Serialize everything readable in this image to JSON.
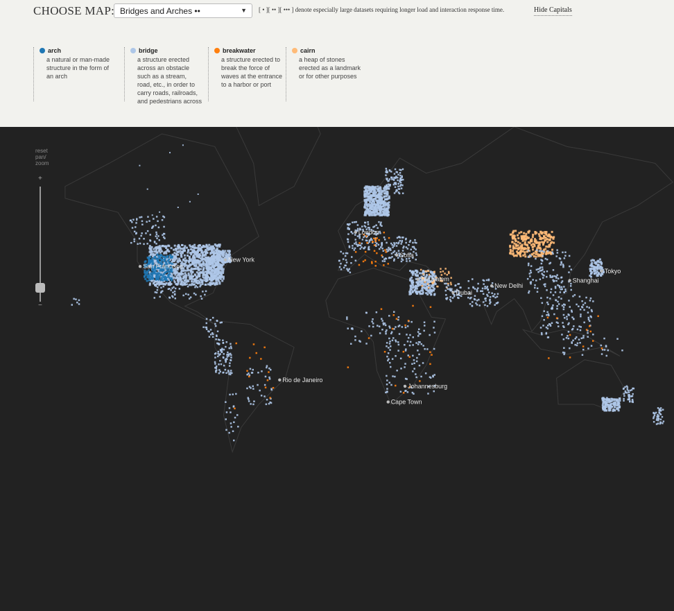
{
  "header": {
    "choose_label": "CHOOSE MAP:",
    "select_value": "Bridges and Arches ••",
    "note": "[ • ][ •• ][ ••• ] denote especially large datasets requiring longer load and interaction response time.",
    "hide_capitals": "Hide Capitals"
  },
  "legend": [
    {
      "name": "arch",
      "color": "#1f77b4",
      "desc": [
        "a natural or man-made",
        "structure in the form of",
        "an arch"
      ]
    },
    {
      "name": "bridge",
      "color": "#aec7e8",
      "desc": [
        "a structure erected",
        "across an obstacle",
        "such as a stream,",
        "road, etc., in order to",
        "carry roads, railroads,",
        "and pedestrians across"
      ]
    },
    {
      "name": "breakwater",
      "color": "#ff7f0e",
      "desc": [
        "a structure erected to",
        "break the force of",
        "waves at the entrance",
        "to a harbor or port"
      ]
    },
    {
      "name": "cairn",
      "color": "#ffbb78",
      "desc": [
        "a heap of stones",
        "erected as a landmark",
        "or for other purposes"
      ]
    }
  ],
  "zoom": {
    "label": [
      "reset",
      "pan/",
      "zoom"
    ],
    "plus": "+",
    "minus": "−",
    "level": 0.08
  },
  "cities": [
    {
      "name": "London",
      "lon": -0.1,
      "lat": 51.5
    },
    {
      "name": "Sofia",
      "lon": 23.3,
      "lat": 42.7
    },
    {
      "name": "Jerusalem",
      "lon": 35.2,
      "lat": 31.8
    },
    {
      "name": "Dubai",
      "lon": 55.3,
      "lat": 25.2
    },
    {
      "name": "New Delhi",
      "lon": 77.2,
      "lat": 28.6
    },
    {
      "name": "Shanghai",
      "lon": 121.5,
      "lat": 31.2
    },
    {
      "name": "Tokyo",
      "lon": 139.7,
      "lat": 35.7
    },
    {
      "name": "San Francisco",
      "lon": -122.4,
      "lat": 37.8
    },
    {
      "name": "New York",
      "lon": -74.0,
      "lat": 40.7
    },
    {
      "name": "Rio de Janeiro",
      "lon": -43.2,
      "lat": -22.9
    },
    {
      "name": "Johannesburg",
      "lon": 28.0,
      "lat": -26.2
    },
    {
      "name": "Cape Town",
      "lon": 18.4,
      "lat": -33.9
    }
  ],
  "colors": {
    "arch": "#1f77b4",
    "bridge": "#aec7e8",
    "breakwater": "#ff7f0e",
    "cairn": "#ffbb78",
    "background": "#222222",
    "land": "#3a3a3a"
  }
}
